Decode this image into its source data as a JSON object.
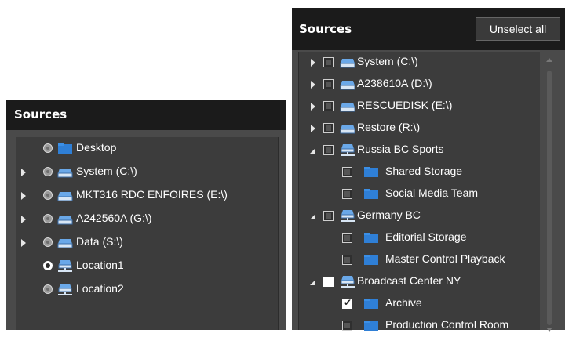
{
  "left_panel": {
    "title": "Sources",
    "items": [
      {
        "label": "Desktop",
        "icon": "folder-icon",
        "expandable": false,
        "selected": false
      },
      {
        "label": "System (C:\\)",
        "icon": "drive-icon",
        "expandable": true,
        "selected": false
      },
      {
        "label": "MKT316 RDC ENFOIRES (E:\\)",
        "icon": "drive-icon",
        "expandable": true,
        "selected": false
      },
      {
        "label": "A242560A (G:\\)",
        "icon": "drive-icon",
        "expandable": true,
        "selected": false
      },
      {
        "label": "Data (S:\\)",
        "icon": "drive-icon",
        "expandable": true,
        "selected": false
      },
      {
        "label": "Location1",
        "icon": "network-location-icon",
        "expandable": false,
        "selected": true
      },
      {
        "label": "Location2",
        "icon": "network-location-icon",
        "expandable": false,
        "selected": false
      }
    ]
  },
  "right_panel": {
    "title": "Sources",
    "unselect_all_label": "Unselect all",
    "items": [
      {
        "label": "System (C:\\)",
        "icon": "drive-icon",
        "arrow": "collapsed",
        "checkbox": "partial"
      },
      {
        "label": "A238610A (D:\\)",
        "icon": "drive-icon",
        "arrow": "collapsed",
        "checkbox": "partial"
      },
      {
        "label": "RESCUEDISK (E:\\)",
        "icon": "drive-icon",
        "arrow": "collapsed",
        "checkbox": "partial"
      },
      {
        "label": "Restore (R:\\)",
        "icon": "drive-icon",
        "arrow": "collapsed",
        "checkbox": "partial"
      },
      {
        "label": "Russia BC Sports",
        "icon": "network-location-icon",
        "arrow": "expanded",
        "checkbox": "partial"
      },
      {
        "label": "Shared Storage",
        "icon": "folder-icon",
        "arrow": "none",
        "checkbox": "partial",
        "child": true
      },
      {
        "label": "Social Media Team",
        "icon": "folder-icon",
        "arrow": "none",
        "checkbox": "partial",
        "child": true
      },
      {
        "label": "Germany BC",
        "icon": "network-location-icon",
        "arrow": "expanded",
        "checkbox": "partial"
      },
      {
        "label": "Editorial Storage",
        "icon": "folder-icon",
        "arrow": "none",
        "checkbox": "partial",
        "child": true
      },
      {
        "label": "Master Control Playback",
        "icon": "folder-icon",
        "arrow": "none",
        "checkbox": "partial",
        "child": true
      },
      {
        "label": "Broadcast Center NY",
        "icon": "network-location-icon",
        "arrow": "expanded",
        "checkbox": "white"
      },
      {
        "label": "Archive",
        "icon": "folder-icon",
        "arrow": "none",
        "checkbox": "checked",
        "child": true
      },
      {
        "label": "Production Control Room",
        "icon": "folder-icon",
        "arrow": "none",
        "checkbox": "partial",
        "child": true
      }
    ]
  },
  "colors": {
    "header_bg": "#1b1b1b",
    "panel_bg": "#4a4a4a",
    "list_bg": "#3c3c3c",
    "folder_blue": "#2f7fd6",
    "text": "#ffffff"
  }
}
